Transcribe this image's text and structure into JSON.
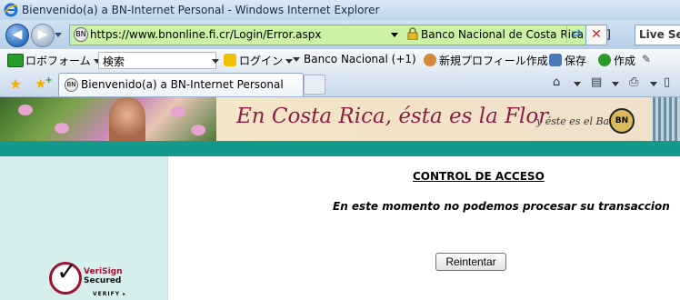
{
  "window": {
    "title": "Bienvenido(a) a BN-Internet Personal - Windows Internet Explorer"
  },
  "address_bar": {
    "url": "https://www.bnonline.fi.cr/Login/Error.aspx",
    "certificate": "Banco Nacional de Costa Rica [CR]",
    "live_search": "Live Sea"
  },
  "toolbar": {
    "roboform": "ロボフォーム",
    "search_placeholder": "検索",
    "login": "ログイン",
    "banco_nacional": "Banco Nacional (+1)",
    "new_profile": "新規プロフィール作成",
    "save": "保存",
    "create": "作成"
  },
  "tab": {
    "title": "Bienvenido(a) a BN-Internet Personal"
  },
  "banner": {
    "slogan": "En Costa Rica, ésta es la Flor",
    "tagline": "y éste es el Banco.",
    "logo_text": "BN"
  },
  "verisign": {
    "line1": "VeriSign",
    "line2": "Secured",
    "line3": "VERIFY ▸"
  },
  "content": {
    "heading": "CONTROL DE ACCESO",
    "message": "En este momento no podemos procesar su transaccion",
    "retry_button": "Reintentar"
  },
  "colors": {
    "address_secure_bg": "#ccf0a6",
    "teal_band": "#139a8a",
    "left_column": "#d6efee",
    "slogan": "#8f1b47"
  }
}
